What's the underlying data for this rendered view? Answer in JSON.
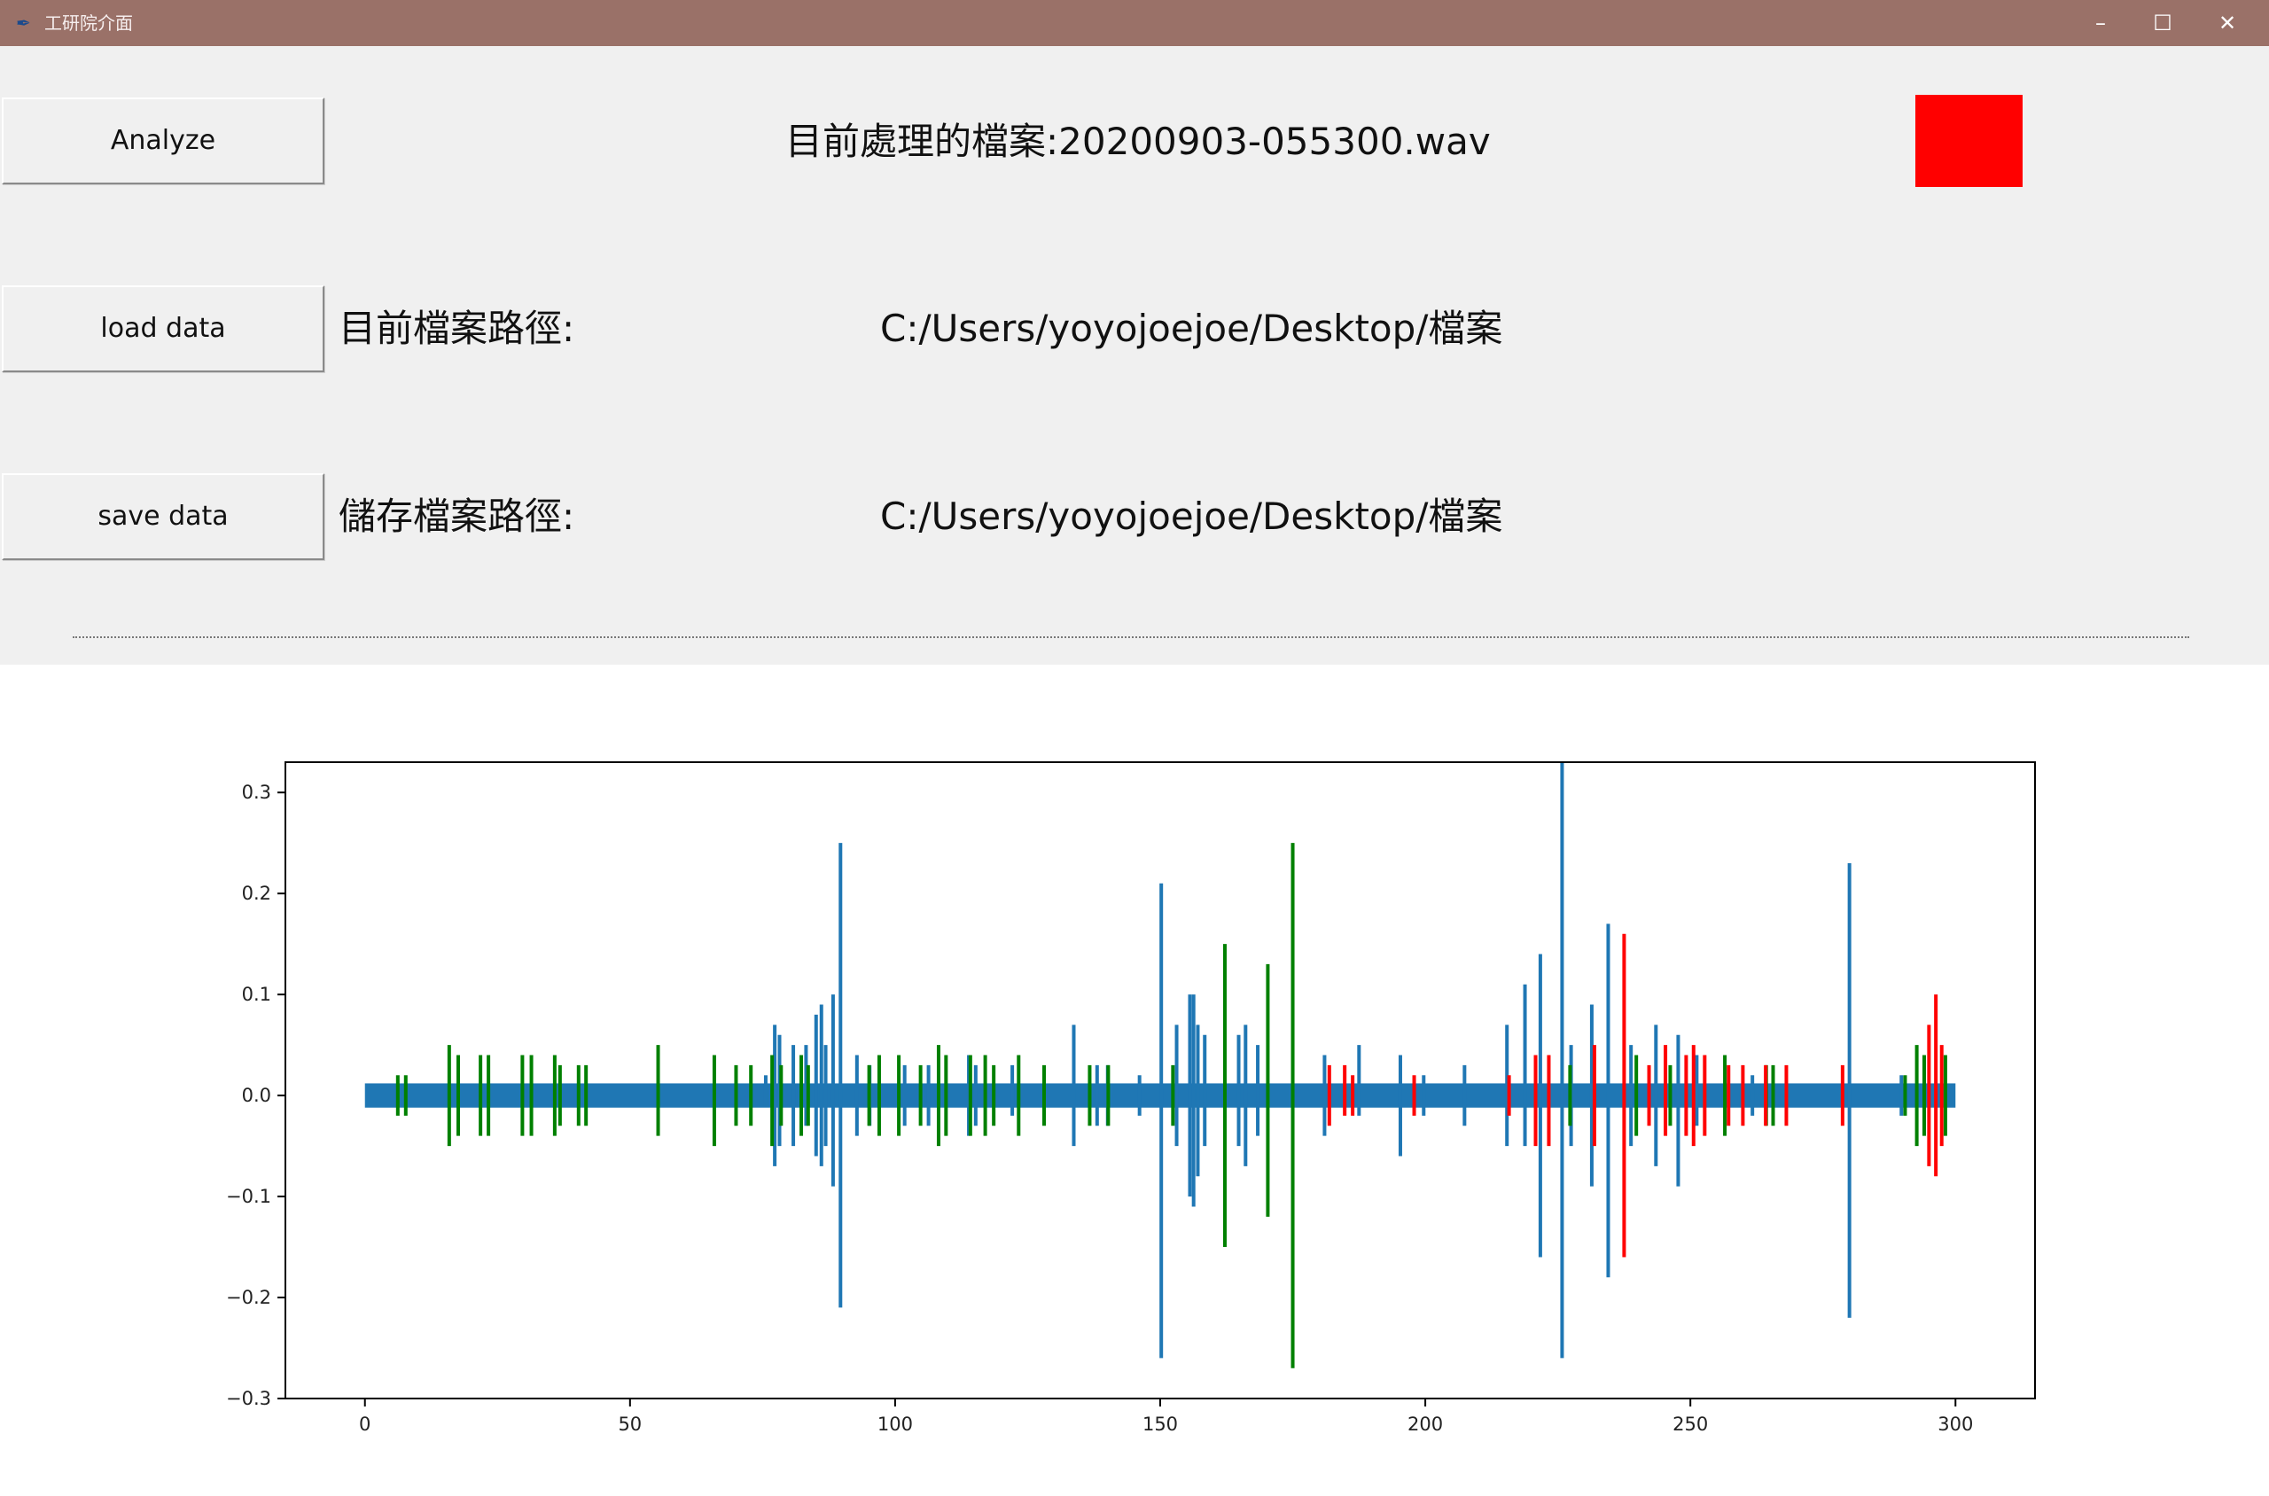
{
  "window": {
    "title": "工研院介面",
    "icons": {
      "app": "feather-icon",
      "minimize": "minimize-icon",
      "maximize": "maximize-icon",
      "close": "close-icon"
    }
  },
  "controls": {
    "analyze_label": "Analyze",
    "load_label": "load data",
    "save_label": "save data",
    "current_file": "目前處理的檔案:20200903-055300.wav",
    "load_path_label": "目前檔案路徑:",
    "load_path": "C:/Users/yoyojoejoe/Desktop/檔案",
    "save_path_label": "儲存檔案路徑:",
    "save_path": "C:/Users/yoyojoejoe/Desktop/檔案",
    "status_color": "#ff0000"
  },
  "chart_data": {
    "type": "line",
    "title": "",
    "xlabel": "",
    "ylabel": "",
    "xlim": [
      -15,
      315
    ],
    "ylim": [
      -0.3,
      0.33
    ],
    "xticks": [
      0,
      50,
      100,
      150,
      200,
      250,
      300
    ],
    "xtick_labels": [
      "0",
      "50",
      "100",
      "150",
      "200",
      "250",
      "300"
    ],
    "yticks": [
      0.3,
      0.2,
      0.1,
      0.0,
      -0.1,
      -0.2,
      -0.3
    ],
    "ytick_labels": [
      "0.3",
      "0.2",
      "0.1",
      "0.0",
      "−0.1",
      "−0.2",
      "−0.3"
    ],
    "grid": false,
    "colors": {
      "waveform": "#1f77b4",
      "green": "#008000",
      "red": "#ff0000"
    },
    "baseline": {
      "x_start": 0,
      "x_end": 300,
      "amplitude": 0.012
    },
    "series": [
      {
        "color": "#1f77b4",
        "spikes": [
          [
            75.6,
            0.02,
            -0.01
          ],
          [
            77.3,
            0.07,
            -0.07
          ],
          [
            78.2,
            0.06,
            -0.05
          ],
          [
            80.8,
            0.05,
            -0.05
          ],
          [
            83.2,
            0.05,
            -0.03
          ],
          [
            85.1,
            0.08,
            -0.06
          ],
          [
            86.1,
            0.09,
            -0.07
          ],
          [
            86.9,
            0.05,
            -0.05
          ],
          [
            88.3,
            0.1,
            -0.09
          ],
          [
            89.7,
            0.25,
            -0.21
          ],
          [
            92.8,
            0.04,
            -0.04
          ],
          [
            95.2,
            0.03,
            -0.03
          ],
          [
            101.8,
            0.03,
            -0.03
          ],
          [
            106.3,
            0.03,
            -0.03
          ],
          [
            113.9,
            0.04,
            -0.04
          ],
          [
            115.2,
            0.03,
            -0.03
          ],
          [
            122.1,
            0.03,
            -0.02
          ],
          [
            133.7,
            0.07,
            -0.05
          ],
          [
            138.1,
            0.03,
            -0.03
          ],
          [
            140.1,
            0.03,
            -0.03
          ],
          [
            146.1,
            0.02,
            -0.02
          ],
          [
            150.2,
            0.21,
            -0.26
          ],
          [
            153.1,
            0.07,
            -0.05
          ],
          [
            155.6,
            0.1,
            -0.1
          ],
          [
            156.3,
            0.1,
            -0.11
          ],
          [
            157.1,
            0.07,
            -0.08
          ],
          [
            158.4,
            0.06,
            -0.05
          ],
          [
            164.8,
            0.06,
            -0.05
          ],
          [
            166.1,
            0.07,
            -0.07
          ],
          [
            168.4,
            0.05,
            -0.04
          ],
          [
            181.0,
            0.04,
            -0.04
          ],
          [
            187.5,
            0.05,
            -0.02
          ],
          [
            195.3,
            0.04,
            -0.06
          ],
          [
            199.7,
            0.02,
            -0.02
          ],
          [
            207.4,
            0.03,
            -0.03
          ],
          [
            215.4,
            0.07,
            -0.05
          ],
          [
            218.8,
            0.11,
            -0.05
          ],
          [
            221.7,
            0.14,
            -0.16
          ],
          [
            225.8,
            0.33,
            -0.26
          ],
          [
            227.5,
            0.05,
            -0.05
          ],
          [
            231.4,
            0.09,
            -0.09
          ],
          [
            234.5,
            0.17,
            -0.18
          ],
          [
            238.8,
            0.05,
            -0.05
          ],
          [
            243.5,
            0.07,
            -0.07
          ],
          [
            247.7,
            0.06,
            -0.09
          ],
          [
            251.2,
            0.04,
            -0.03
          ],
          [
            261.7,
            0.02,
            -0.02
          ],
          [
            280.0,
            0.23,
            -0.22
          ],
          [
            289.8,
            0.02,
            -0.02
          ]
        ]
      },
      {
        "color": "#008000",
        "spikes": [
          [
            6.2,
            0.02,
            -0.02
          ],
          [
            7.7,
            0.02,
            -0.02
          ],
          [
            15.9,
            0.05,
            -0.05
          ],
          [
            17.6,
            0.04,
            -0.04
          ],
          [
            21.8,
            0.04,
            -0.04
          ],
          [
            23.3,
            0.04,
            -0.04
          ],
          [
            29.7,
            0.04,
            -0.04
          ],
          [
            31.4,
            0.04,
            -0.04
          ],
          [
            35.8,
            0.04,
            -0.04
          ],
          [
            36.8,
            0.03,
            -0.03
          ],
          [
            40.3,
            0.03,
            -0.03
          ],
          [
            41.7,
            0.03,
            -0.03
          ],
          [
            55.3,
            0.05,
            -0.04
          ],
          [
            65.9,
            0.04,
            -0.05
          ],
          [
            70.0,
            0.03,
            -0.03
          ],
          [
            72.8,
            0.03,
            -0.03
          ],
          [
            76.8,
            0.04,
            -0.05
          ],
          [
            78.5,
            0.03,
            -0.03
          ],
          [
            82.3,
            0.04,
            -0.04
          ],
          [
            83.6,
            0.03,
            -0.03
          ],
          [
            95.1,
            0.03,
            -0.03
          ],
          [
            97.0,
            0.04,
            -0.04
          ],
          [
            100.7,
            0.04,
            -0.04
          ],
          [
            104.8,
            0.03,
            -0.03
          ],
          [
            108.2,
            0.05,
            -0.05
          ],
          [
            109.6,
            0.04,
            -0.04
          ],
          [
            114.2,
            0.04,
            -0.04
          ],
          [
            117.0,
            0.04,
            -0.04
          ],
          [
            118.6,
            0.03,
            -0.03
          ],
          [
            123.3,
            0.04,
            -0.04
          ],
          [
            128.1,
            0.03,
            -0.03
          ],
          [
            136.7,
            0.03,
            -0.03
          ],
          [
            140.2,
            0.03,
            -0.03
          ],
          [
            152.4,
            0.03,
            -0.03
          ],
          [
            162.2,
            0.15,
            -0.15
          ],
          [
            170.3,
            0.13,
            -0.12
          ],
          [
            175.0,
            0.25,
            -0.27
          ],
          [
            227.3,
            0.03,
            -0.03
          ],
          [
            239.8,
            0.04,
            -0.04
          ],
          [
            246.2,
            0.03,
            -0.03
          ],
          [
            256.5,
            0.04,
            -0.04
          ],
          [
            264.3,
            0.03,
            -0.03
          ],
          [
            265.6,
            0.03,
            -0.03
          ],
          [
            290.5,
            0.02,
            -0.02
          ],
          [
            292.7,
            0.05,
            -0.05
          ],
          [
            294.1,
            0.04,
            -0.04
          ],
          [
            298.1,
            0.04,
            -0.04
          ]
        ]
      },
      {
        "color": "#ff0000",
        "spikes": [
          [
            181.9,
            0.03,
            -0.03
          ],
          [
            184.8,
            0.03,
            -0.02
          ],
          [
            186.3,
            0.02,
            -0.02
          ],
          [
            197.9,
            0.02,
            -0.02
          ],
          [
            215.8,
            0.02,
            -0.02
          ],
          [
            220.8,
            0.04,
            -0.05
          ],
          [
            223.3,
            0.04,
            -0.05
          ],
          [
            231.9,
            0.05,
            -0.05
          ],
          [
            237.5,
            0.16,
            -0.16
          ],
          [
            242.2,
            0.03,
            -0.03
          ],
          [
            245.3,
            0.05,
            -0.04
          ],
          [
            249.2,
            0.04,
            -0.04
          ],
          [
            250.6,
            0.05,
            -0.05
          ],
          [
            252.7,
            0.04,
            -0.04
          ],
          [
            257.2,
            0.03,
            -0.03
          ],
          [
            259.9,
            0.03,
            -0.03
          ],
          [
            264.2,
            0.03,
            -0.03
          ],
          [
            268.1,
            0.03,
            -0.03
          ],
          [
            278.7,
            0.03,
            -0.03
          ],
          [
            295.0,
            0.07,
            -0.07
          ],
          [
            296.3,
            0.1,
            -0.08
          ],
          [
            297.4,
            0.05,
            -0.05
          ]
        ]
      }
    ]
  }
}
